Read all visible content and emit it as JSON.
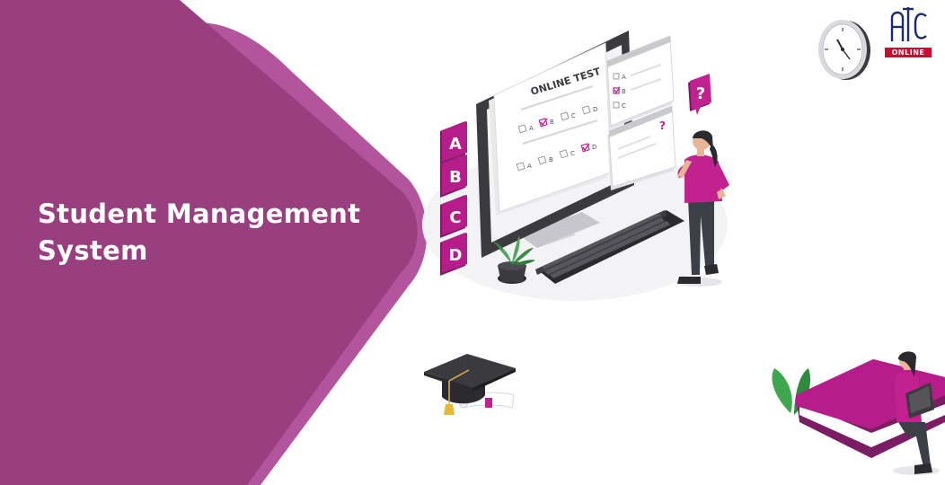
{
  "hero": {
    "title_line1": "Student Management",
    "title_line2": "System"
  },
  "logo": {
    "tagline": "ONLINE",
    "brand_color": "#c8102e",
    "mark_color": "#1a2a6c"
  },
  "illustration": {
    "screen_title": "ONLINE TEST",
    "options": [
      "A",
      "B",
      "C",
      "D"
    ],
    "popup_question_mark": "?",
    "answer_letters": [
      "A",
      "B",
      "C",
      "D"
    ],
    "floating_question_mark": "?"
  },
  "colors": {
    "accent": "#993f7f",
    "accent_light": "#b3559d",
    "magenta": "#c2228f"
  }
}
